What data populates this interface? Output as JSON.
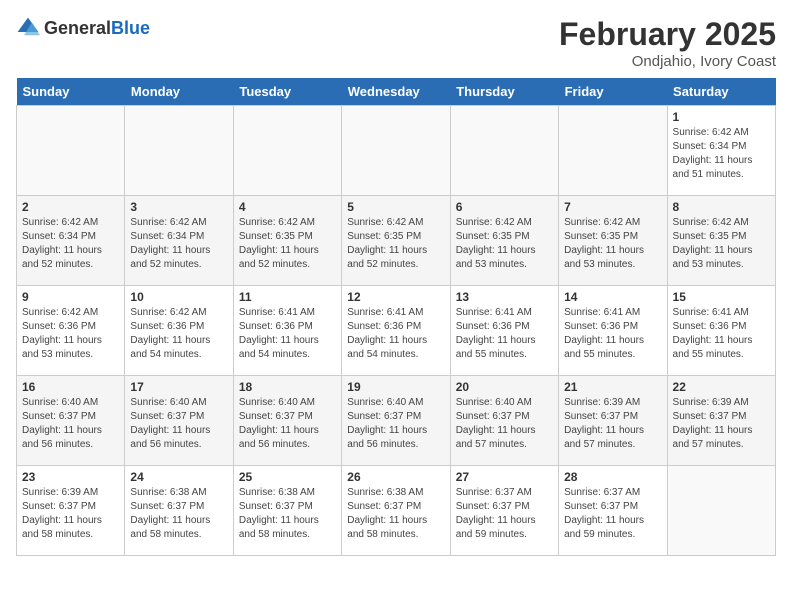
{
  "logo": {
    "general": "General",
    "blue": "Blue"
  },
  "title": "February 2025",
  "subtitle": "Ondjahio, Ivory Coast",
  "weekdays": [
    "Sunday",
    "Monday",
    "Tuesday",
    "Wednesday",
    "Thursday",
    "Friday",
    "Saturday"
  ],
  "weeks": [
    [
      {
        "day": "",
        "info": ""
      },
      {
        "day": "",
        "info": ""
      },
      {
        "day": "",
        "info": ""
      },
      {
        "day": "",
        "info": ""
      },
      {
        "day": "",
        "info": ""
      },
      {
        "day": "",
        "info": ""
      },
      {
        "day": "1",
        "info": "Sunrise: 6:42 AM\nSunset: 6:34 PM\nDaylight: 11 hours and 51 minutes."
      }
    ],
    [
      {
        "day": "2",
        "info": "Sunrise: 6:42 AM\nSunset: 6:34 PM\nDaylight: 11 hours and 52 minutes."
      },
      {
        "day": "3",
        "info": "Sunrise: 6:42 AM\nSunset: 6:34 PM\nDaylight: 11 hours and 52 minutes."
      },
      {
        "day": "4",
        "info": "Sunrise: 6:42 AM\nSunset: 6:35 PM\nDaylight: 11 hours and 52 minutes."
      },
      {
        "day": "5",
        "info": "Sunrise: 6:42 AM\nSunset: 6:35 PM\nDaylight: 11 hours and 52 minutes."
      },
      {
        "day": "6",
        "info": "Sunrise: 6:42 AM\nSunset: 6:35 PM\nDaylight: 11 hours and 53 minutes."
      },
      {
        "day": "7",
        "info": "Sunrise: 6:42 AM\nSunset: 6:35 PM\nDaylight: 11 hours and 53 minutes."
      },
      {
        "day": "8",
        "info": "Sunrise: 6:42 AM\nSunset: 6:35 PM\nDaylight: 11 hours and 53 minutes."
      }
    ],
    [
      {
        "day": "9",
        "info": "Sunrise: 6:42 AM\nSunset: 6:36 PM\nDaylight: 11 hours and 53 minutes."
      },
      {
        "day": "10",
        "info": "Sunrise: 6:42 AM\nSunset: 6:36 PM\nDaylight: 11 hours and 54 minutes."
      },
      {
        "day": "11",
        "info": "Sunrise: 6:41 AM\nSunset: 6:36 PM\nDaylight: 11 hours and 54 minutes."
      },
      {
        "day": "12",
        "info": "Sunrise: 6:41 AM\nSunset: 6:36 PM\nDaylight: 11 hours and 54 minutes."
      },
      {
        "day": "13",
        "info": "Sunrise: 6:41 AM\nSunset: 6:36 PM\nDaylight: 11 hours and 55 minutes."
      },
      {
        "day": "14",
        "info": "Sunrise: 6:41 AM\nSunset: 6:36 PM\nDaylight: 11 hours and 55 minutes."
      },
      {
        "day": "15",
        "info": "Sunrise: 6:41 AM\nSunset: 6:36 PM\nDaylight: 11 hours and 55 minutes."
      }
    ],
    [
      {
        "day": "16",
        "info": "Sunrise: 6:40 AM\nSunset: 6:37 PM\nDaylight: 11 hours and 56 minutes."
      },
      {
        "day": "17",
        "info": "Sunrise: 6:40 AM\nSunset: 6:37 PM\nDaylight: 11 hours and 56 minutes."
      },
      {
        "day": "18",
        "info": "Sunrise: 6:40 AM\nSunset: 6:37 PM\nDaylight: 11 hours and 56 minutes."
      },
      {
        "day": "19",
        "info": "Sunrise: 6:40 AM\nSunset: 6:37 PM\nDaylight: 11 hours and 56 minutes."
      },
      {
        "day": "20",
        "info": "Sunrise: 6:40 AM\nSunset: 6:37 PM\nDaylight: 11 hours and 57 minutes."
      },
      {
        "day": "21",
        "info": "Sunrise: 6:39 AM\nSunset: 6:37 PM\nDaylight: 11 hours and 57 minutes."
      },
      {
        "day": "22",
        "info": "Sunrise: 6:39 AM\nSunset: 6:37 PM\nDaylight: 11 hours and 57 minutes."
      }
    ],
    [
      {
        "day": "23",
        "info": "Sunrise: 6:39 AM\nSunset: 6:37 PM\nDaylight: 11 hours and 58 minutes."
      },
      {
        "day": "24",
        "info": "Sunrise: 6:38 AM\nSunset: 6:37 PM\nDaylight: 11 hours and 58 minutes."
      },
      {
        "day": "25",
        "info": "Sunrise: 6:38 AM\nSunset: 6:37 PM\nDaylight: 11 hours and 58 minutes."
      },
      {
        "day": "26",
        "info": "Sunrise: 6:38 AM\nSunset: 6:37 PM\nDaylight: 11 hours and 58 minutes."
      },
      {
        "day": "27",
        "info": "Sunrise: 6:37 AM\nSunset: 6:37 PM\nDaylight: 11 hours and 59 minutes."
      },
      {
        "day": "28",
        "info": "Sunrise: 6:37 AM\nSunset: 6:37 PM\nDaylight: 11 hours and 59 minutes."
      },
      {
        "day": "",
        "info": ""
      }
    ]
  ]
}
